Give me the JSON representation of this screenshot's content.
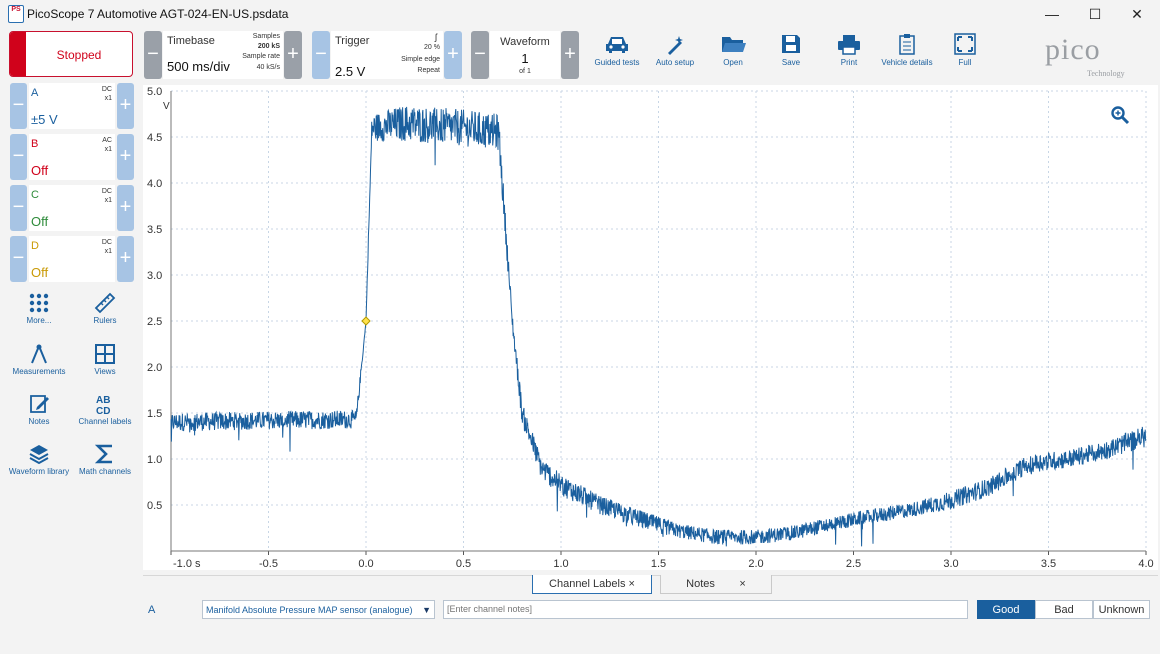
{
  "window": {
    "title": "PicoScope 7 Automotive AGT-024-EN-US.psdata",
    "app_icon_text": "PS",
    "controls": {
      "minimize": "—",
      "maximize": "☐",
      "close": "✕"
    }
  },
  "run": {
    "status_label": "Stopped",
    "color": "#d0021b"
  },
  "timebase": {
    "label": "Timebase",
    "value": "500 ms/div",
    "samples_label": "Samples",
    "samples": "200 kS",
    "rate_label": "Sample rate",
    "rate": "40 kS/s"
  },
  "trigger": {
    "label": "Trigger",
    "value": "2.5 V",
    "percent": "20 %",
    "type": "Simple edge",
    "mode": "Repeat",
    "edge_symbol": "ʃ"
  },
  "waveform": {
    "label": "Waveform",
    "value": "1",
    "of": "of 1"
  },
  "tools": [
    {
      "label": "Guided tests",
      "icon": "car-icon"
    },
    {
      "label": "Auto setup",
      "icon": "wand-icon"
    },
    {
      "label": "Open",
      "icon": "folder-icon"
    },
    {
      "label": "Save",
      "icon": "save-icon"
    },
    {
      "label": "Print",
      "icon": "printer-icon"
    },
    {
      "label": "Vehicle details",
      "icon": "clipboard-icon"
    },
    {
      "label": "Full",
      "icon": "fullscreen-icon"
    }
  ],
  "brand": {
    "word": "pico",
    "sub": "Technology"
  },
  "channels": [
    {
      "name": "A",
      "coupling": "DC",
      "probe": "x1",
      "range": "±5 V",
      "color": "#1a5f9e"
    },
    {
      "name": "B",
      "coupling": "AC",
      "probe": "x1",
      "range": "Off",
      "color": "#d0021b"
    },
    {
      "name": "C",
      "coupling": "DC",
      "probe": "x1",
      "range": "Off",
      "color": "#2e8b3a"
    },
    {
      "name": "D",
      "coupling": "DC",
      "probe": "x1",
      "range": "Off",
      "color": "#c99a06"
    }
  ],
  "side_tools": [
    {
      "label": "More...",
      "icon": "grid-dots-icon"
    },
    {
      "label": "Rulers",
      "icon": "ruler-icon"
    },
    {
      "label": "Measurements",
      "icon": "caliper-icon"
    },
    {
      "label": "Views",
      "icon": "views-grid-icon"
    },
    {
      "label": "Notes",
      "icon": "notes-icon"
    },
    {
      "label": "Channel labels",
      "icon": "abcd-icon"
    },
    {
      "label": "Waveform library",
      "icon": "stack-icon"
    },
    {
      "label": "Math channels",
      "icon": "sigma-icon"
    }
  ],
  "chart_data": {
    "type": "line",
    "yunit": "V",
    "ylim": [
      0,
      5.0
    ],
    "xlim": [
      -1.0,
      4.0
    ],
    "xunit": "s",
    "y_ticks": [
      "5.0",
      "4.5",
      "4.0",
      "3.5",
      "3.0",
      "2.5",
      "2.0",
      "1.5",
      "1.0",
      "0.5"
    ],
    "x_ticks": [
      "-1.0 s",
      "-0.5",
      "0.0",
      "0.5",
      "1.0",
      "1.5",
      "2.0",
      "2.5",
      "3.0",
      "3.5",
      "4.0"
    ],
    "grid": true,
    "trigger_marker": {
      "x": 0.0,
      "y": 2.5
    },
    "series": [
      {
        "color": "#1a5f9e",
        "x": [
          -1.0,
          -0.5,
          -0.05,
          0.0,
          0.03,
          0.2,
          0.5,
          0.68,
          0.75,
          0.8,
          0.9,
          1.0,
          1.2,
          1.4,
          1.6,
          1.8,
          2.0,
          2.2,
          2.4,
          2.6,
          2.8,
          3.0,
          3.2,
          3.4,
          3.6,
          3.8,
          4.0
        ],
        "y": [
          1.4,
          1.42,
          1.43,
          2.5,
          4.6,
          4.65,
          4.6,
          4.55,
          2.5,
          1.5,
          0.9,
          0.72,
          0.5,
          0.35,
          0.22,
          0.15,
          0.15,
          0.2,
          0.3,
          0.38,
          0.45,
          0.55,
          0.7,
          0.95,
          1.0,
          1.1,
          1.25
        ],
        "noise": [
          0.1,
          0.1,
          0.1,
          0.0,
          0.15,
          0.2,
          0.2,
          0.2,
          0.1,
          0.12,
          0.12,
          0.12,
          0.1,
          0.1,
          0.08,
          0.08,
          0.08,
          0.08,
          0.08,
          0.08,
          0.08,
          0.1,
          0.1,
          0.1,
          0.1,
          0.1,
          0.12
        ]
      }
    ]
  },
  "bottom": {
    "tabs": [
      {
        "label": "Channel Labels",
        "close": "×"
      },
      {
        "label": "Notes",
        "close": "×"
      }
    ],
    "channel": "A",
    "label_value": "Manifold Absolute Pressure MAP sensor (analogue)",
    "notes_placeholder": "[Enter channel notes]",
    "quality": [
      "Good",
      "Bad",
      "Unknown"
    ]
  }
}
